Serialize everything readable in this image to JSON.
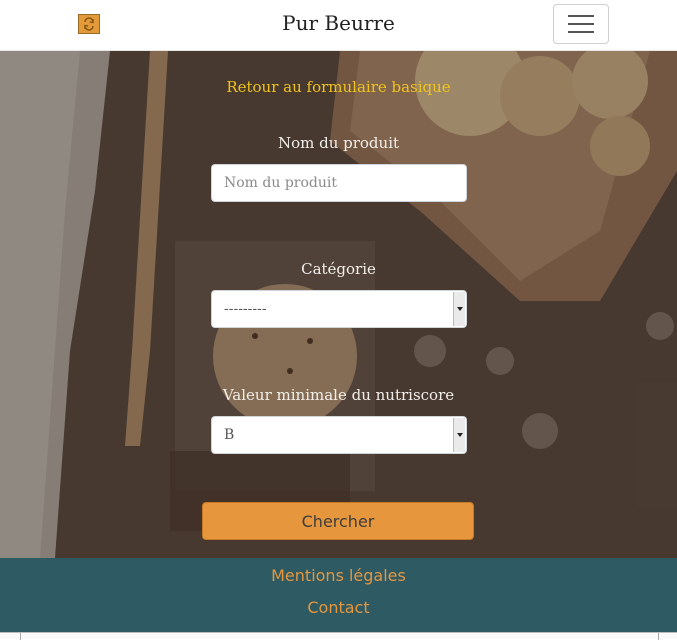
{
  "navbar": {
    "brand": "Pur Beurre",
    "logo_icon": "swap-icon",
    "menu_icon": "hamburger-menu-icon"
  },
  "form": {
    "back_link": "Retour au formulaire basique",
    "product": {
      "label": "Nom du produit",
      "placeholder": "Nom du produit",
      "value": ""
    },
    "category": {
      "label": "Catégorie",
      "selected": "---------"
    },
    "nutriscore": {
      "label": "Valeur minimale du nutriscore",
      "selected": "B"
    },
    "submit_label": "Chercher"
  },
  "footer": {
    "legal": "Mentions légales",
    "contact": "Contact"
  },
  "colors": {
    "accent": "#e6963d",
    "link_yellow": "#f0c419",
    "footer_bg": "#2e5a63"
  }
}
